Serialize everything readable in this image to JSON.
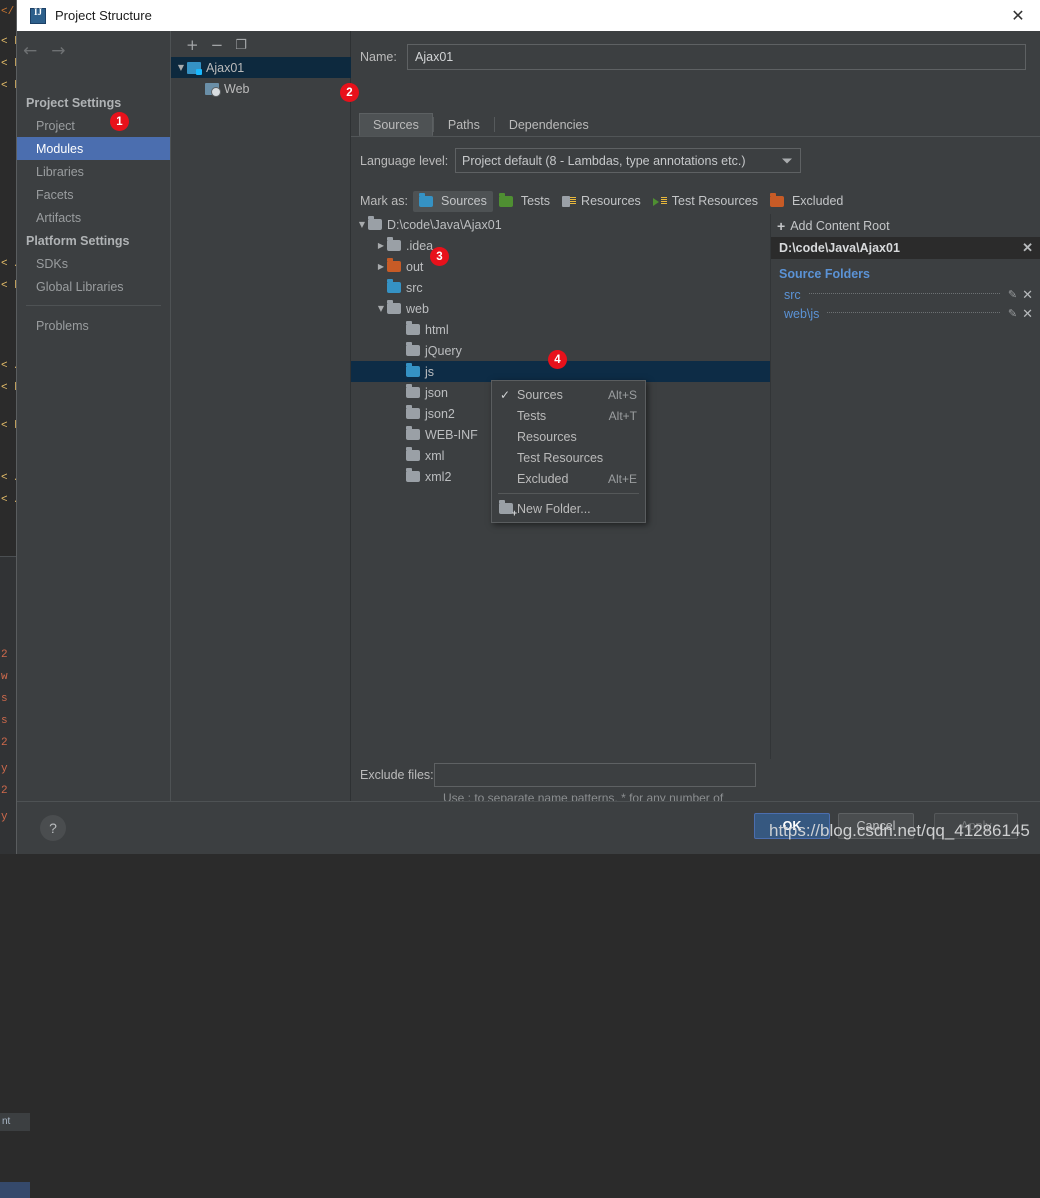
{
  "window": {
    "title": "Project Structure",
    "app_icon": "intellij-idea-icon",
    "close_label": "✕"
  },
  "sidebar": {
    "back_icon": "←",
    "forward_icon": "→",
    "groups": [
      {
        "label": "Project Settings"
      },
      {
        "label": "Platform Settings"
      }
    ],
    "items": [
      {
        "label": "Project",
        "selected": false
      },
      {
        "label": "Modules",
        "selected": true
      },
      {
        "label": "Libraries",
        "selected": false
      },
      {
        "label": "Facets",
        "selected": false
      },
      {
        "label": "Artifacts",
        "selected": false
      },
      {
        "label": "SDKs",
        "selected": false
      },
      {
        "label": "Global Libraries",
        "selected": false
      },
      {
        "label": "Problems",
        "selected": false
      }
    ]
  },
  "modules_panel": {
    "toolbar": {
      "add_label": "+",
      "remove_label": "−",
      "copy_label": "❐"
    },
    "tree": [
      {
        "label": "Ajax01",
        "icon": "module-icon",
        "selected": true,
        "expanded": true
      },
      {
        "label": "Web",
        "icon": "web-facet-icon",
        "selected": false
      }
    ]
  },
  "main": {
    "name_label": "Name:",
    "name_value": "Ajax01",
    "tabs": [
      {
        "label": "Sources",
        "active": true
      },
      {
        "label": "Paths",
        "active": false
      },
      {
        "label": "Dependencies",
        "active": false
      }
    ],
    "language_level": {
      "label": "Language level:",
      "value": "Project default (8 - Lambdas, type annotations etc.)"
    },
    "mark_as": {
      "label": "Mark as:",
      "options": [
        {
          "label": "Sources",
          "icon": "blue-folder-icon",
          "active": true
        },
        {
          "label": "Tests",
          "icon": "green-folder-icon",
          "active": false
        },
        {
          "label": "Resources",
          "icon": "resources-icon",
          "active": false
        },
        {
          "label": "Test Resources",
          "icon": "test-resources-icon",
          "active": false
        },
        {
          "label": "Excluded",
          "icon": "orange-folder-icon",
          "active": false
        }
      ]
    },
    "file_tree": [
      {
        "label": "D:\\code\\Java\\Ajax01",
        "indent": 0,
        "icon": "grey",
        "arrow": "down",
        "selected": false
      },
      {
        "label": ".idea",
        "indent": 1,
        "icon": "grey",
        "arrow": "right",
        "selected": false
      },
      {
        "label": "out",
        "indent": 1,
        "icon": "orange",
        "arrow": "right",
        "selected": false
      },
      {
        "label": "src",
        "indent": 1,
        "icon": "blue",
        "arrow": "none",
        "selected": false
      },
      {
        "label": "web",
        "indent": 1,
        "icon": "grey",
        "arrow": "down",
        "selected": false
      },
      {
        "label": "html",
        "indent": 2,
        "icon": "grey",
        "arrow": "none",
        "selected": false
      },
      {
        "label": "jQuery",
        "indent": 2,
        "icon": "grey",
        "arrow": "none",
        "selected": false
      },
      {
        "label": "js",
        "indent": 2,
        "icon": "blue",
        "arrow": "none",
        "selected": true
      },
      {
        "label": "json",
        "indent": 2,
        "icon": "grey",
        "arrow": "none",
        "selected": false
      },
      {
        "label": "json2",
        "indent": 2,
        "icon": "grey",
        "arrow": "none",
        "selected": false
      },
      {
        "label": "WEB-INF",
        "indent": 2,
        "icon": "grey",
        "arrow": "none",
        "selected": false
      },
      {
        "label": "xml",
        "indent": 2,
        "icon": "grey",
        "arrow": "none",
        "selected": false
      },
      {
        "label": "xml2",
        "indent": 2,
        "icon": "grey",
        "arrow": "none",
        "selected": false
      }
    ],
    "exclude": {
      "label": "Exclude files:",
      "value": "",
      "hint": "Use ; to separate name patterns, * for any number of symbols, ? for one."
    }
  },
  "context_menu": {
    "items": [
      {
        "label": "Sources",
        "accel": "Alt+S",
        "checked": true,
        "icon": ""
      },
      {
        "label": "Tests",
        "accel": "Alt+T",
        "checked": false,
        "icon": ""
      },
      {
        "label": "Resources",
        "accel": "",
        "checked": false,
        "icon": ""
      },
      {
        "label": "Test Resources",
        "accel": "",
        "checked": false,
        "icon": ""
      },
      {
        "label": "Excluded",
        "accel": "Alt+E",
        "checked": false,
        "icon": ""
      }
    ],
    "new_folder": {
      "label": "New Folder...",
      "icon": "new-folder-icon"
    },
    "check_glyph": "✓"
  },
  "content_root_panel": {
    "add_content_root": {
      "label": "Add Content Root",
      "plus": "+"
    },
    "root_path": "D:\\code\\Java\\Ajax01",
    "root_remove": "✕",
    "source_folders_title": "Source Folders",
    "source_folders": [
      {
        "label": "src",
        "edit_icon": "✎",
        "remove_icon": "✕"
      },
      {
        "label": "web\\js",
        "edit_icon": "✎",
        "remove_icon": "✕"
      }
    ]
  },
  "footer": {
    "help_label": "?",
    "ok_label": "OK",
    "cancel_label": "Cancel",
    "apply_label": "Apply"
  },
  "annotations": {
    "badge1": "1",
    "badge2": "2",
    "badge3": "3",
    "badge4": "4"
  },
  "watermark": "https://blog.csdn.net/qq_41286145",
  "colors": {
    "accent_blue": "#4b6eaf",
    "badge_red": "#e8111b",
    "link_blue": "#5b93d6",
    "selection_navy": "#0d2c46",
    "panel_bg": "#3c3f41"
  }
}
